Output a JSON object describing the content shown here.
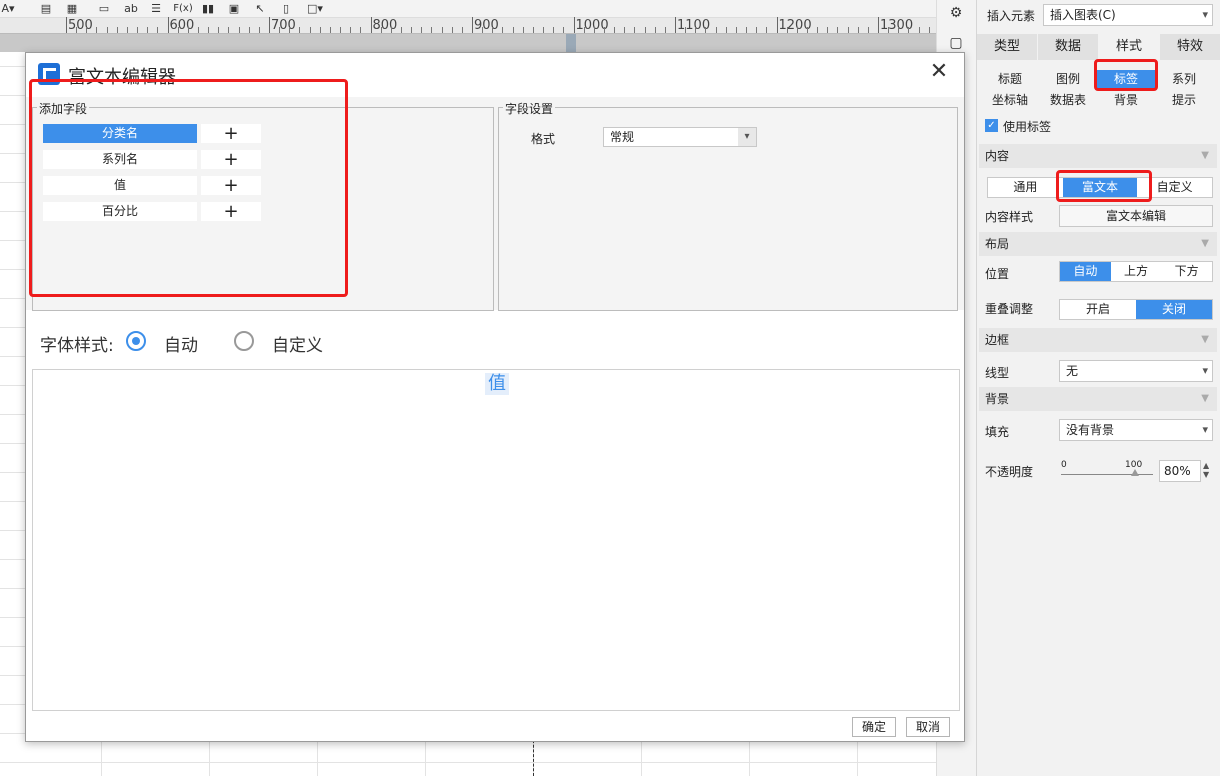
{
  "toolbar": {
    "icons": [
      "font-color-icon",
      "table-icon",
      "grid-icon",
      "field-icon",
      "text-ab-icon",
      "align-icon",
      "formula-icon",
      "chart-icon",
      "image-icon",
      "brush-icon",
      "copy-icon",
      "border-icon"
    ],
    "ab_label": "ab",
    "formula_label": "F(x)"
  },
  "ruler": {
    "labels": [
      "500",
      "600",
      "700",
      "800",
      "900",
      "1000",
      "1100",
      "1200",
      "1300"
    ]
  },
  "panel": {
    "insert_label": "插入元素",
    "insert_value": "插入图表(C)",
    "tabs": [
      "类型",
      "数据",
      "样式",
      "特效"
    ],
    "subtabs_row1": [
      "标题",
      "图例",
      "标签",
      "系列"
    ],
    "subtabs_row2": [
      "坐标轴",
      "数据表",
      "背景",
      "提示"
    ],
    "use_label": "使用标签",
    "section_content": "内容",
    "content_options": [
      "通用",
      "富文本",
      "自定义"
    ],
    "content_style_label": "内容样式",
    "content_style_button": "富文本编辑",
    "section_layout": "布局",
    "position_label": "位置",
    "position_options": [
      "自动",
      "上方",
      "下方"
    ],
    "overlap_label": "重叠调整",
    "overlap_options": [
      "开启",
      "关闭"
    ],
    "section_border": "边框",
    "line_type_label": "线型",
    "line_type_value": "无",
    "section_background": "背景",
    "fill_label": "填充",
    "fill_value": "没有背景",
    "opacity_label": "不透明度",
    "opacity_min": "0",
    "opacity_max": "100",
    "opacity_value": "80%",
    "opacity_level": 0.8
  },
  "dialog": {
    "title": "富文本编辑器",
    "add_field_title": "添加字段",
    "fields": [
      "分类名",
      "系列名",
      "值",
      "百分比"
    ],
    "add_symbol": "+",
    "field_settings_title": "字段设置",
    "format_label": "格式",
    "format_value": "常规",
    "font_style_label": "字体样式:",
    "font_style_options": [
      "自动",
      "自定义"
    ],
    "editor_value": "值",
    "ok_button": "确定",
    "cancel_button": "取消"
  },
  "colors": {
    "accent": "#3d8fea",
    "highlight": "#ee1c1c"
  }
}
